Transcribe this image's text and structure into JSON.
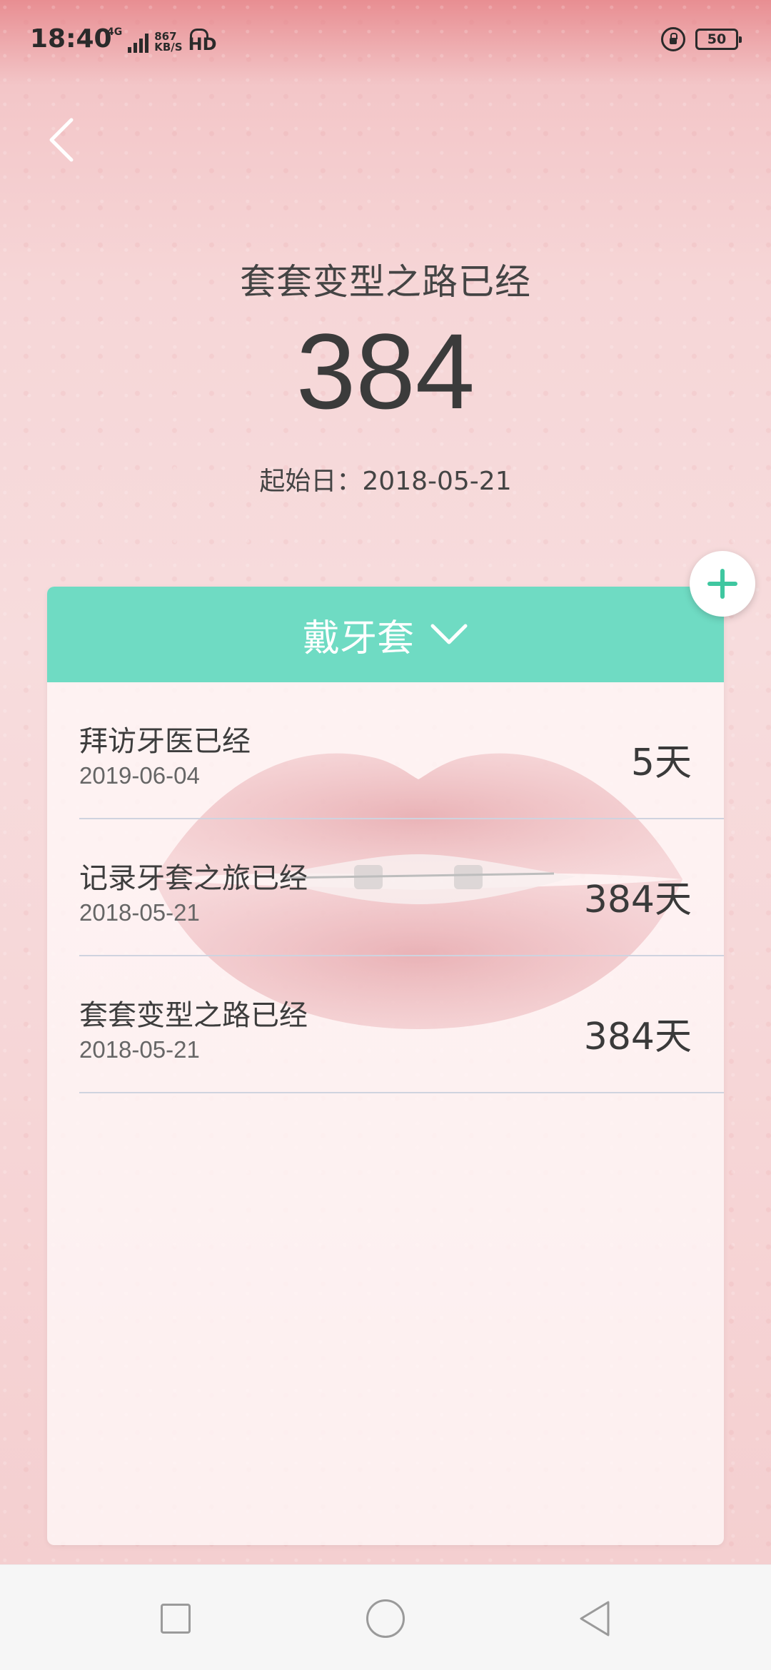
{
  "status_bar": {
    "time": "18:40",
    "network": "4G",
    "speed_value": "867",
    "speed_unit": "KB/S",
    "hd": "HD",
    "battery": "50"
  },
  "header": {
    "title": "套套变型之路已经",
    "days": "384",
    "start_date": "起始日：2018-05-21"
  },
  "card": {
    "category_label": "戴牙套",
    "items": [
      {
        "title": "拜访牙医已经",
        "date": "2019-06-04",
        "days": "5天"
      },
      {
        "title": "记录牙套之旅已经",
        "date": "2018-05-21",
        "days": "384天"
      },
      {
        "title": "套套变型之路已经",
        "date": "2018-05-21",
        "days": "384天"
      }
    ]
  },
  "icons": {
    "back": "chevron-left-icon",
    "dropdown": "chevron-down-icon",
    "add": "plus-icon",
    "nav_recent": "square-icon",
    "nav_home": "circle-icon",
    "nav_back": "triangle-back-icon"
  },
  "colors": {
    "accent": "#6fdbc3",
    "add_plus": "#3fc7a0",
    "background": "#f6d6d7"
  }
}
